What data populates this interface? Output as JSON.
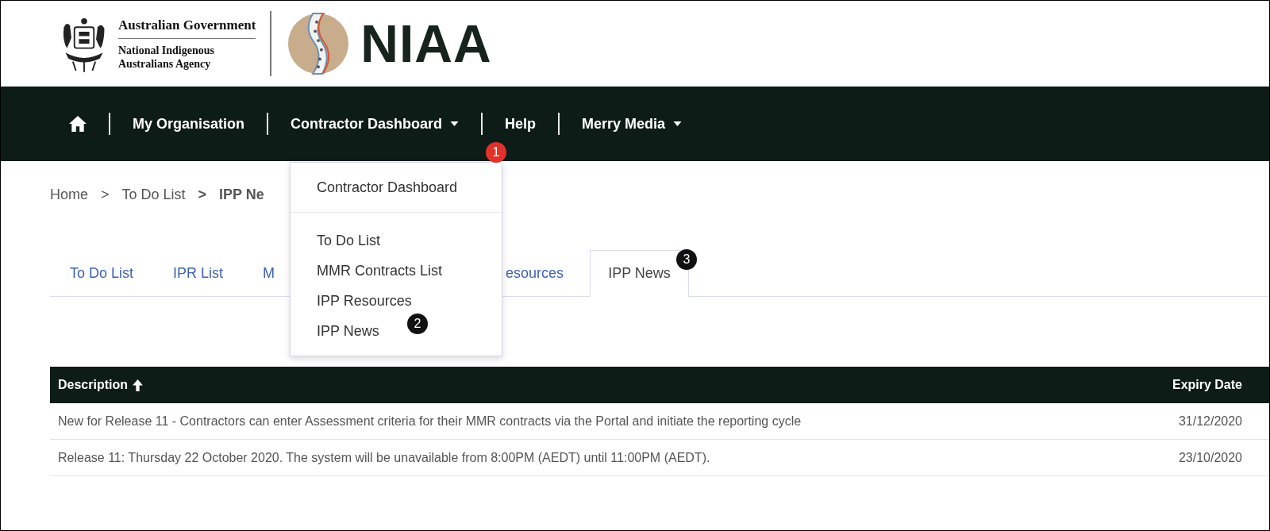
{
  "header": {
    "government": "Australian Government",
    "agency_lines": [
      "National Indigenous",
      "Australians Agency"
    ],
    "brand": "NIAA"
  },
  "nav": {
    "items": [
      {
        "label": "My Organisation",
        "has_menu": false
      },
      {
        "label": "Contractor Dashboard",
        "has_menu": true
      },
      {
        "label": "Help",
        "has_menu": false
      },
      {
        "label": "Merry Media",
        "has_menu": true
      }
    ]
  },
  "dropdown": {
    "groups": [
      [
        "Contractor Dashboard"
      ],
      [
        "To Do List",
        "MMR Contracts List",
        "IPP Resources",
        "IPP News"
      ]
    ]
  },
  "breadcrumb": [
    {
      "label": "Home",
      "current": false
    },
    {
      "sep": ">",
      "label": "To Do List",
      "current": false
    },
    {
      "sep": ">",
      "label": "IPP Ne",
      "current": true
    }
  ],
  "tabs": [
    {
      "label": "To Do List",
      "selected": false
    },
    {
      "label": "IPR List",
      "selected": false
    },
    {
      "label": "M",
      "selected": false
    },
    {
      "label": "esources",
      "selected": false
    },
    {
      "label": "IPP News",
      "selected": true
    }
  ],
  "table": {
    "columns": [
      {
        "label": "Description",
        "sorted": true
      },
      {
        "label": "Expiry Date",
        "sorted": false
      }
    ],
    "rows": [
      [
        "New for Release 11 - Contractors can enter Assessment criteria for their MMR contracts via the Portal and initiate the reporting cycle",
        "31/12/2020"
      ],
      [
        "Release 11: Thursday 22 October 2020. The system will be unavailable from 8:00PM (AEDT) until 11:00PM (AEDT).",
        "23/10/2020"
      ]
    ]
  },
  "callouts": [
    {
      "label": "1",
      "color": "#e0322b"
    },
    {
      "label": "2",
      "color": "#111111"
    },
    {
      "label": "3",
      "color": "#111111"
    }
  ]
}
